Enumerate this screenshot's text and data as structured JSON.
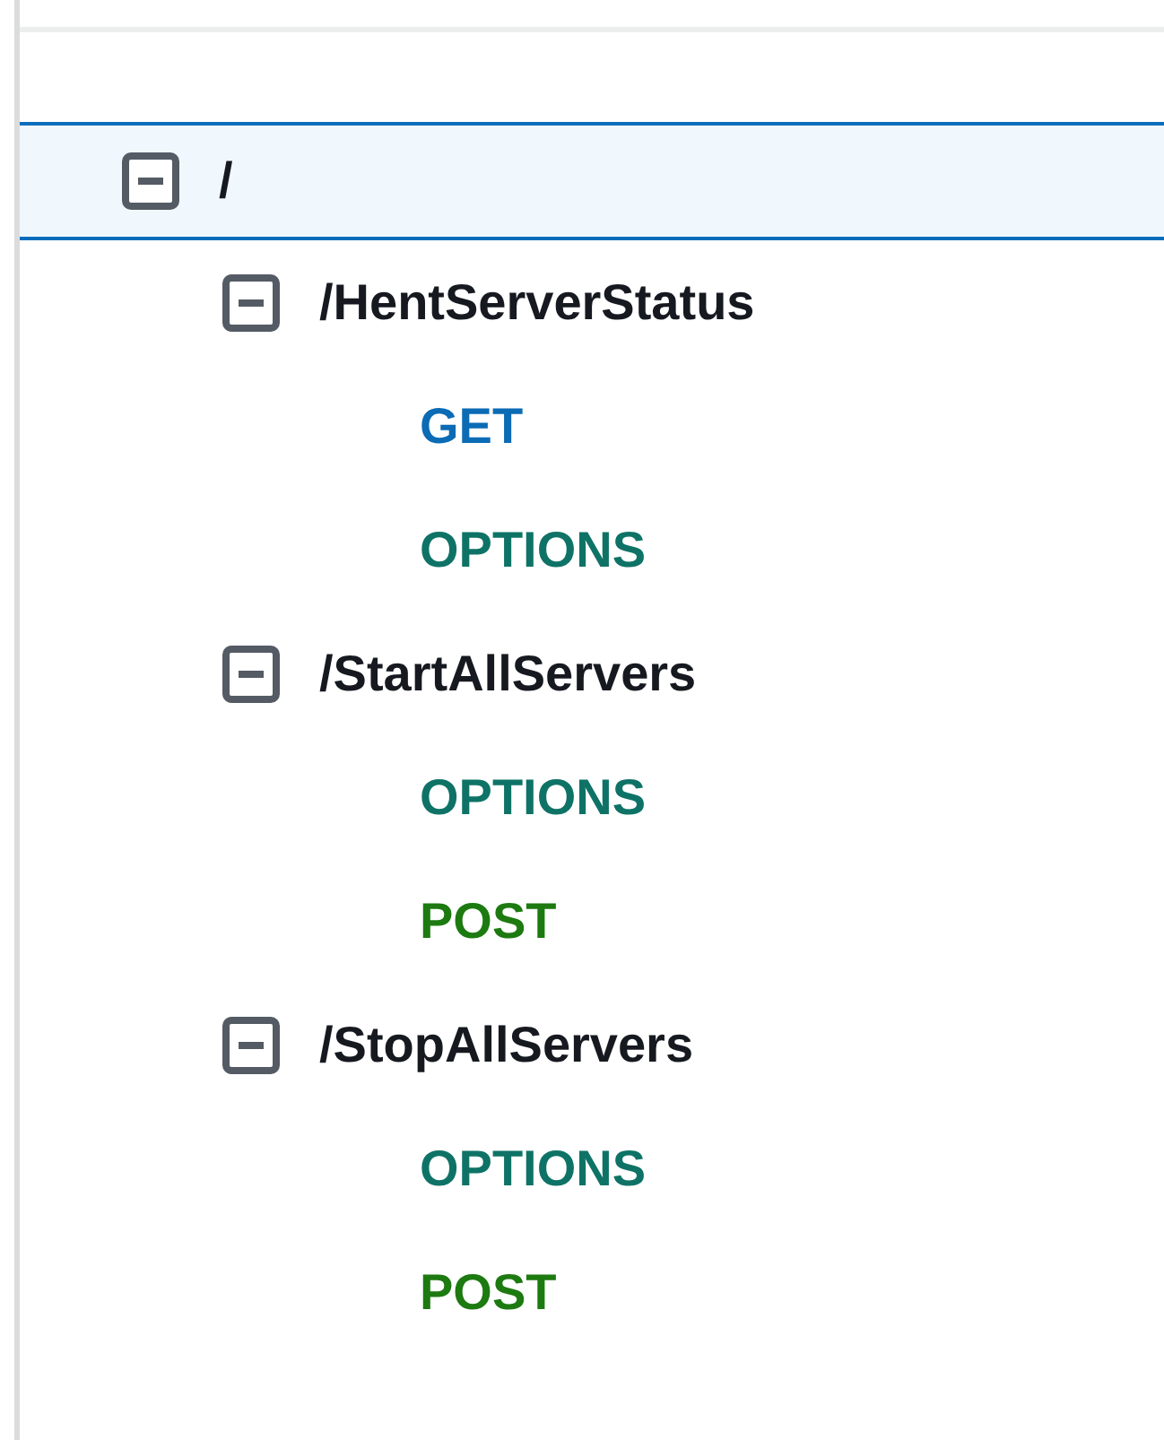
{
  "tree": [
    {
      "path": "/",
      "selected": true,
      "expanded": true,
      "children": [
        {
          "path": "/HentServerStatus",
          "selected": false,
          "expanded": true,
          "methods": [
            {
              "name": "GET",
              "selected": false,
              "color": "#0b6bb5"
            },
            {
              "name": "OPTIONS",
              "selected": false,
              "color": "#0e7366"
            }
          ]
        },
        {
          "path": "/StartAllServers",
          "selected": false,
          "expanded": true,
          "methods": [
            {
              "name": "OPTIONS",
              "selected": false,
              "color": "#0e7366"
            },
            {
              "name": "POST",
              "selected": false,
              "color": "#1d7a10"
            }
          ]
        },
        {
          "path": "/StopAllServers",
          "selected": false,
          "expanded": true,
          "methods": [
            {
              "name": "OPTIONS",
              "selected": false,
              "color": "#0e7366"
            },
            {
              "name": "POST",
              "selected": false,
              "color": "#1d7a10"
            }
          ]
        }
      ]
    }
  ]
}
